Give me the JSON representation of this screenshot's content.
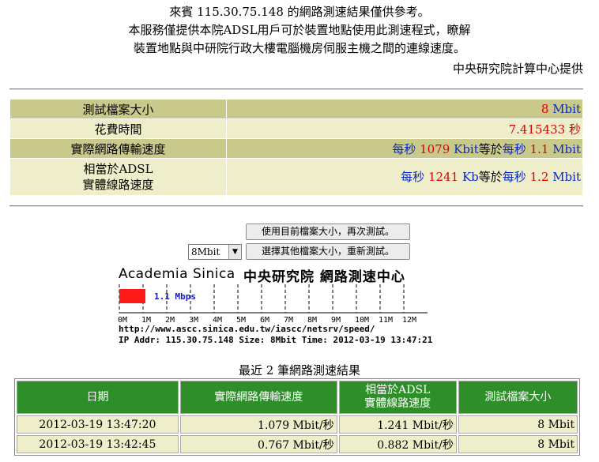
{
  "intro": {
    "line1": "來賓 115.30.75.148 的網路測速結果僅供參考。",
    "line2": "本服務僅提供本院ADSL用戶可於裝置地點使用此測速程式，瞭解",
    "line3": "裝置地點與中研院行政大樓電腦機房伺服主機之間的連線速度。",
    "provider": "中央研究院計算中心提供"
  },
  "summary": {
    "file_size": {
      "label": "測試檔案大小",
      "value": "8",
      "unit": "Mbit"
    },
    "time_spent": {
      "label": "花費時間",
      "value": "7.415433",
      "unit": "秒"
    },
    "actual_speed": {
      "label": "實際網路傳輸速度",
      "per_sec": "每秒",
      "kbit_value": "1079",
      "kbit_unit": "Kbit",
      "equals": "等於",
      "mbit_value": "1.1",
      "mbit_unit": "Mbit"
    },
    "adsl_speed": {
      "label_line1": "相當於ADSL",
      "label_line2": "實體線路速度",
      "per_sec": "每秒",
      "kb_value": "1241",
      "kb_unit": "Kb",
      "equals": "等於",
      "mbit_value": "1.2",
      "mbit_unit": "Mbit"
    }
  },
  "controls": {
    "retest_button": "使用目前檔案大小，再次測試。",
    "select_value": "8Mbit",
    "select_other_button": "選擇其他檔案大小，重新測試。"
  },
  "speed_image": {
    "logo_latin": "Academia Sinica",
    "logo_cjk": "中央研究院 網路測速中心",
    "speed_label": "1.1 Mbps",
    "speed_mbps": 1.1,
    "bar_color": "#ff1a1a",
    "ticks": [
      "0M",
      "1M",
      "2M",
      "3M",
      "4M",
      "5M",
      "6M",
      "7M",
      "8M",
      "9M",
      "10M",
      "11M",
      "12M"
    ],
    "url": "http://www.ascc.sinica.edu.tw/iascc/netsrv/speed/",
    "ip_line": "IP Addr: 115.30.75.148 Size: 8Mbit Time: 2012-03-19 13:47:21"
  },
  "results": {
    "title": "最近 2 筆網路測速結果",
    "headers": [
      "日期",
      "實際網路傳輸速度",
      "相當於ADSL\n實體線路速度",
      "測試檔案大小"
    ],
    "rows": [
      [
        "2012-03-19 13:47:20",
        "1.079 Mbit/秒",
        "1.241 Mbit/秒",
        "8 Mbit"
      ],
      [
        "2012-03-19 13:42:45",
        "0.767 Mbit/秒",
        "0.882 Mbit/秒",
        "8 Mbit"
      ]
    ],
    "header_color": "#2e8f2a"
  }
}
